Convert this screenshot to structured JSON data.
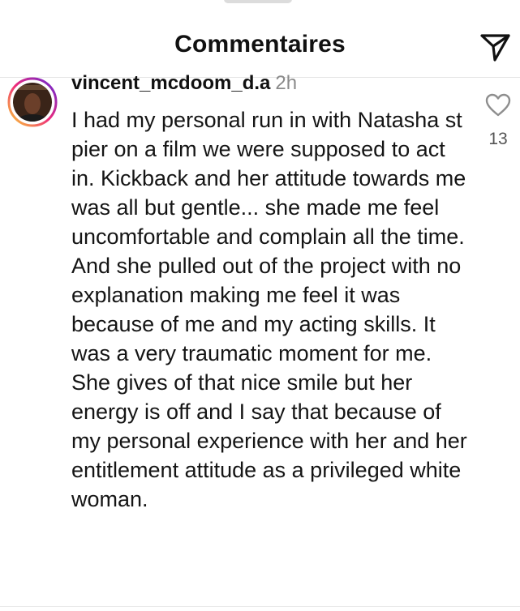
{
  "header": {
    "title": "Commentaires",
    "share_icon": "send-paper-plane-icon"
  },
  "comment": {
    "username": "vincent_mcdoom_d.a",
    "timestamp": "2h",
    "text": "I had my personal run in with Natasha st pier on a film we were supposed to act in. Kickback and her attitude towards me was all but gentle... she made me feel uncomfortable and complain all the time. And she pulled out of the project with no explanation making me feel it was because of me and my acting skills. It was a very traumatic moment for me. She gives of that nice smile but her energy is off and I say that because of my personal experience with her and her entitlement attitude as a privileged white woman.",
    "likes": "13",
    "like_icon": "heart-outline-icon",
    "avatar_ring_colors": [
      "#f9ce34",
      "#ee2a7b",
      "#6228d7"
    ]
  }
}
